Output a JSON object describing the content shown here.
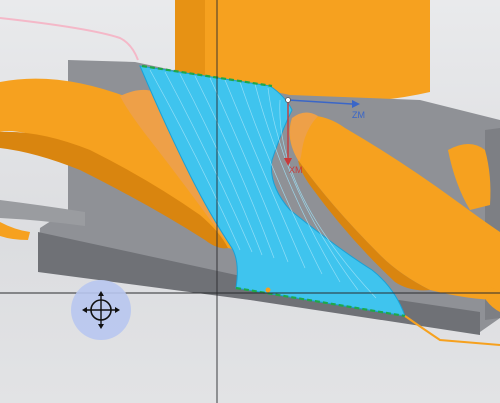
{
  "viewport": {
    "axis_labels": {
      "zm": "ZM",
      "xm": "XM"
    },
    "colors": {
      "background": "#e4e5e7",
      "part_orange": "#f6a11f",
      "part_orange_shade": "#d9850f",
      "fixture_gray": "#8f9196",
      "fixture_gray_dark": "#6f7176",
      "toolpath_cyan": "#3fc4ee",
      "toolpath_edge": "#1aa1d6",
      "engagement_green": "#1fa84a",
      "axis_blue": "#3a66c8",
      "axis_red": "#c83a3a",
      "cursor_bg": "#b8c6f0"
    },
    "icons": [
      "move-crosshair-icon",
      "wcs-axis-triad-icon"
    ]
  }
}
